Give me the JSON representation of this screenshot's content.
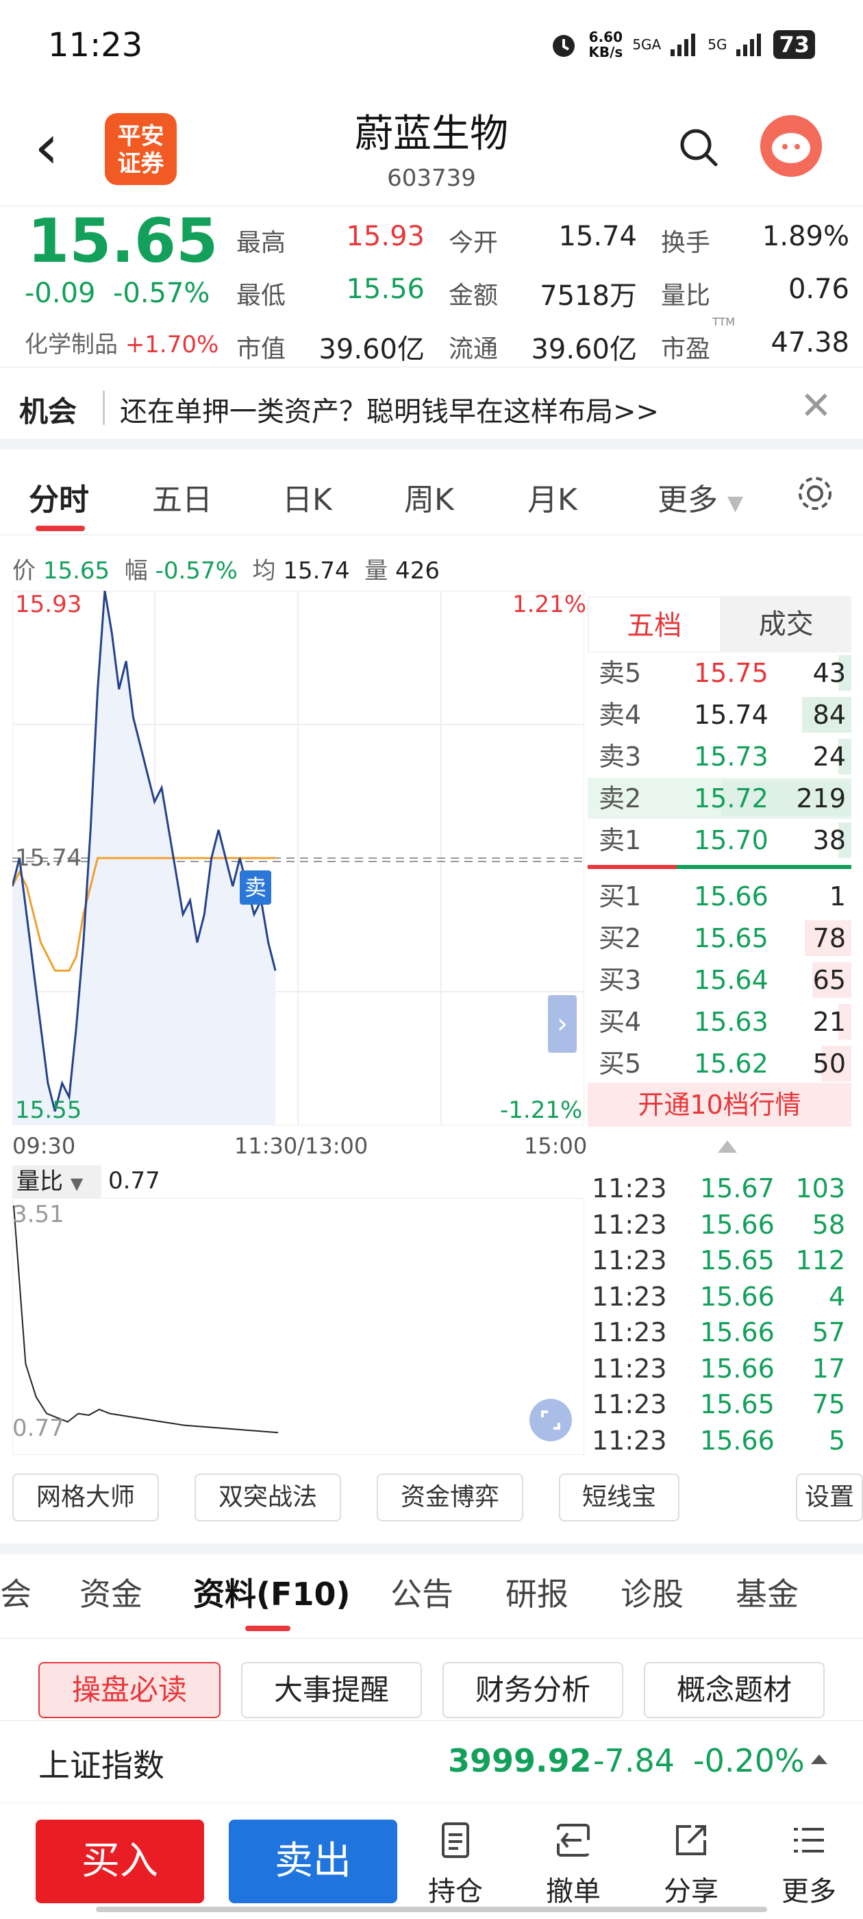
{
  "status": {
    "time": "11:23",
    "speed_value": "6.60",
    "speed_unit": "KB/s",
    "net1": "5GA",
    "net2": "5G",
    "battery": "73"
  },
  "header": {
    "title": "蔚蓝生物",
    "code": "603739",
    "logo_line1": "平安",
    "logo_line2": "证券"
  },
  "quote": {
    "price": "15.65",
    "change": "-0.09",
    "change_pct": "-0.57%",
    "sector_name": "化学制品",
    "sector_pct": "+1.70%",
    "high_label": "最高",
    "high": "15.93",
    "open_label": "今开",
    "open": "15.74",
    "turnover_label": "换手",
    "turnover": "1.89%",
    "low_label": "最低",
    "low": "15.56",
    "amount_label": "金额",
    "amount": "7518万",
    "vol_ratio_label": "量比",
    "vol_ratio": "0.76",
    "mcap_label": "市值",
    "mcap": "39.60亿",
    "float_label": "流通",
    "float": "39.60亿",
    "pe_label": "市盈",
    "pe_sup": "TTM",
    "pe": "47.38"
  },
  "opportunity": {
    "tag": "机会",
    "text": "还在单押一类资产？聪明钱早在这样布局>>"
  },
  "ktabs": [
    "分时",
    "五日",
    "日K",
    "周K",
    "月K",
    "更多"
  ],
  "info": {
    "price_label": "价",
    "price": "15.65",
    "amp_label": "幅",
    "amp": "-0.57%",
    "avg_label": "均",
    "avg": "15.74",
    "vol_label": "量",
    "vol": "426"
  },
  "chart_labels": {
    "top_left": "15.93",
    "top_right": "1.21%",
    "mid_left": "15.74",
    "bottom_left": "15.55",
    "bottom_right": "-1.21%",
    "t_start": "09:30",
    "t_mid": "11:30/13:00",
    "t_end": "15:00",
    "sell_marker": "卖"
  },
  "volume_labels": {
    "selector": "量比",
    "value": "0.77",
    "top": "3.51",
    "bottom": "0.77"
  },
  "chart_data": {
    "type": "line",
    "x_range": [
      "09:30",
      "15:00"
    ],
    "ylim": [
      15.55,
      15.93
    ],
    "series": [
      {
        "values": [
          15.72,
          15.74,
          15.7,
          15.66,
          15.62,
          15.58,
          15.56,
          15.58,
          15.57,
          15.62,
          15.68,
          15.76,
          15.86,
          15.93,
          15.9,
          15.86,
          15.88,
          15.84,
          15.82,
          15.8,
          15.78,
          15.79,
          15.76,
          15.73,
          15.7,
          15.71,
          15.68,
          15.7,
          15.74,
          15.76,
          15.74,
          15.72,
          15.74,
          15.72,
          15.7,
          15.71,
          15.68,
          15.66
        ]
      },
      {
        "values": [
          15.72,
          15.73,
          15.72,
          15.7,
          15.68,
          15.67,
          15.66,
          15.66,
          15.66,
          15.67,
          15.7,
          15.72,
          15.74,
          15.74,
          15.74,
          15.74,
          15.74,
          15.74,
          15.74,
          15.74,
          15.74,
          15.74,
          15.74,
          15.74,
          15.74,
          15.74,
          15.74,
          15.74,
          15.74,
          15.74,
          15.74,
          15.74,
          15.74,
          15.74,
          15.74,
          15.74,
          15.74,
          15.74
        ]
      }
    ],
    "volume_ratio": [
      3.51,
      1.6,
      1.2,
      1.0,
      0.95,
      0.9,
      1.0,
      0.98,
      1.05,
      1.0,
      0.98,
      0.96,
      0.94,
      0.92,
      0.9,
      0.88,
      0.86,
      0.85,
      0.84,
      0.83,
      0.82,
      0.81,
      0.8,
      0.79,
      0.78,
      0.77
    ]
  },
  "orderbook": {
    "tabs": [
      "五档",
      "成交"
    ],
    "sells": [
      {
        "label": "卖5",
        "price": "15.75",
        "qty": "43",
        "bar": 0.1,
        "hl": false
      },
      {
        "label": "卖4",
        "price": "15.74",
        "qty": "84",
        "bar": 0.38,
        "hl": false
      },
      {
        "label": "卖3",
        "price": "15.73",
        "qty": "24",
        "bar": 0.1,
        "hl": false
      },
      {
        "label": "卖2",
        "price": "15.72",
        "qty": "219",
        "bar": 1.0,
        "hl": true
      },
      {
        "label": "卖1",
        "price": "15.70",
        "qty": "38",
        "bar": 0.1,
        "hl": false
      }
    ],
    "buys": [
      {
        "label": "买1",
        "price": "15.66",
        "qty": "1",
        "bar": 0.0
      },
      {
        "label": "买2",
        "price": "15.65",
        "qty": "78",
        "bar": 0.36
      },
      {
        "label": "买3",
        "price": "15.64",
        "qty": "65",
        "bar": 0.3
      },
      {
        "label": "买4",
        "price": "15.63",
        "qty": "21",
        "bar": 0.1
      },
      {
        "label": "买5",
        "price": "15.62",
        "qty": "50",
        "bar": 0.23
      }
    ],
    "open10": "开通10档行情"
  },
  "trades": [
    {
      "t": "11:23",
      "p": "15.67",
      "q": "103"
    },
    {
      "t": "11:23",
      "p": "15.66",
      "q": "58"
    },
    {
      "t": "11:23",
      "p": "15.65",
      "q": "112"
    },
    {
      "t": "11:23",
      "p": "15.66",
      "q": "4"
    },
    {
      "t": "11:23",
      "p": "15.66",
      "q": "57"
    },
    {
      "t": "11:23",
      "p": "15.66",
      "q": "17"
    },
    {
      "t": "11:23",
      "p": "15.65",
      "q": "75"
    },
    {
      "t": "11:23",
      "p": "15.66",
      "q": "5"
    }
  ],
  "tools": [
    "网格大师",
    "双突战法",
    "资金博弈",
    "短线宝",
    "设置"
  ],
  "f10tabs": [
    "会",
    "资金",
    "资料(F10)",
    "公告",
    "研报",
    "诊股",
    "基金"
  ],
  "pills": [
    "操盘必读",
    "大事提醒",
    "财务分析",
    "概念题材"
  ],
  "index": {
    "name": "上证指数",
    "value": "3999.92",
    "change": "-7.84",
    "pct": "-0.20%"
  },
  "bottom": {
    "buy": "买入",
    "sell": "卖出",
    "hold": "持仓",
    "cancel": "撤单",
    "share": "分享",
    "more": "更多"
  }
}
